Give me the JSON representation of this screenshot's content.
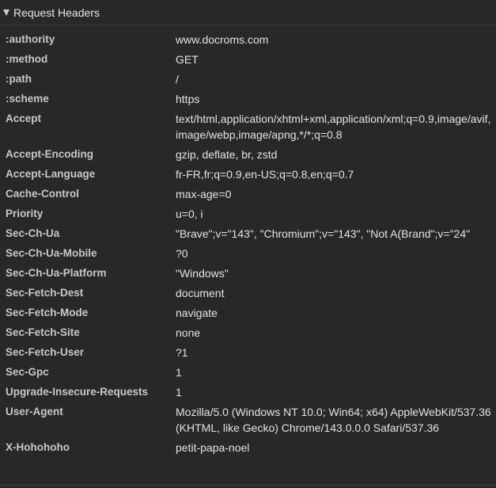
{
  "section": {
    "title": "Request Headers",
    "expanded": true
  },
  "headers": [
    {
      "name": ":authority",
      "value": "www.docroms.com"
    },
    {
      "name": ":method",
      "value": "GET"
    },
    {
      "name": ":path",
      "value": "/"
    },
    {
      "name": ":scheme",
      "value": "https"
    },
    {
      "name": "Accept",
      "value": "text/html,application/xhtml+xml,application/xml;q=0.9,image/avif,image/webp,image/apng,*/*;q=0.8"
    },
    {
      "name": "Accept-Encoding",
      "value": "gzip, deflate, br, zstd"
    },
    {
      "name": "Accept-Language",
      "value": "fr-FR,fr;q=0.9,en-US;q=0.8,en;q=0.7"
    },
    {
      "name": "Cache-Control",
      "value": "max-age=0"
    },
    {
      "name": "Priority",
      "value": "u=0, i"
    },
    {
      "name": "Sec-Ch-Ua",
      "value": "\"Brave\";v=\"143\", \"Chromium\";v=\"143\", \"Not A(Brand\";v=\"24\""
    },
    {
      "name": "Sec-Ch-Ua-Mobile",
      "value": "?0"
    },
    {
      "name": "Sec-Ch-Ua-Platform",
      "value": "\"Windows\""
    },
    {
      "name": "Sec-Fetch-Dest",
      "value": "document"
    },
    {
      "name": "Sec-Fetch-Mode",
      "value": "navigate"
    },
    {
      "name": "Sec-Fetch-Site",
      "value": "none"
    },
    {
      "name": "Sec-Fetch-User",
      "value": "?1"
    },
    {
      "name": "Sec-Gpc",
      "value": "1"
    },
    {
      "name": "Upgrade-Insecure-Requests",
      "value": "1"
    },
    {
      "name": "User-Agent",
      "value": "Mozilla/5.0 (Windows NT 10.0; Win64; x64) AppleWebKit/537.36 (KHTML, like Gecko) Chrome/143.0.0.0 Safari/537.36"
    },
    {
      "name": "X-Hohohoho",
      "value": "petit-papa-noel"
    }
  ]
}
